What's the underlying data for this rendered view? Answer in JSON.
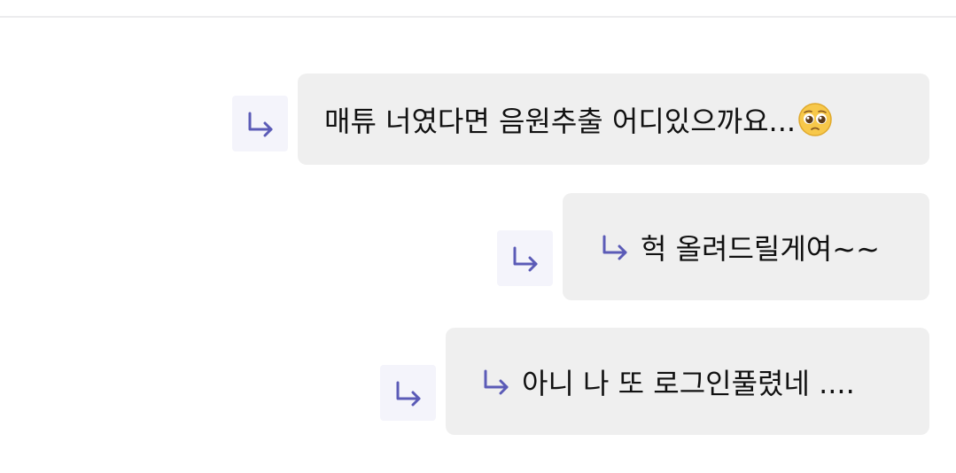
{
  "thread": {
    "messages": [
      {
        "text": "매튜 너였다면 음원추출 어디있으까요...",
        "emoji": "pleading-face",
        "is_reply": false
      },
      {
        "text": "헉 올려드릴게여~~",
        "is_reply": true
      },
      {
        "text": "아니 나 또 로그인풀렸네 ....",
        "is_reply": true
      }
    ]
  },
  "colors": {
    "bubble_bg": "#efefef",
    "reply_button_bg": "#f4f4fb",
    "accent_arrow": "#5b5bb7",
    "text": "#111111",
    "divider": "#ececee"
  },
  "icons": {
    "reply_button": "reply-arrow-icon",
    "inline_reply": "reply-arrow-icon",
    "emoji": "pleading-face-emoji"
  }
}
